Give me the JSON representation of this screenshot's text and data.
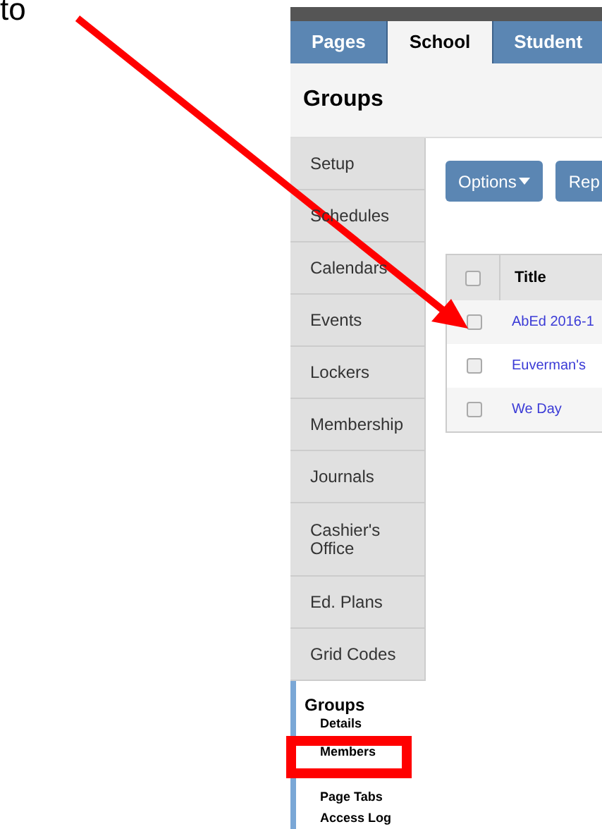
{
  "caption": "to",
  "tabs": [
    {
      "label": "Pages",
      "selected": false
    },
    {
      "label": "School",
      "selected": true
    },
    {
      "label": "Student",
      "selected": false
    }
  ],
  "page_title": "Groups",
  "sidebar": {
    "items": [
      "Setup",
      "Schedules",
      "Calendars",
      "Events",
      "Lockers",
      "Membership",
      "Journals",
      "Cashier's Office",
      "Ed. Plans",
      "Grid Codes"
    ],
    "section": {
      "title": "Groups",
      "links": [
        "Details",
        "Members",
        "Page Tabs",
        "Access Log"
      ]
    }
  },
  "toolbar": {
    "buttons": [
      {
        "label": "Options",
        "kind": "menu"
      },
      {
        "label": "Rep",
        "kind": "plain"
      }
    ]
  },
  "table": {
    "header_checked": false,
    "columns": [
      "Title"
    ],
    "rows": [
      {
        "title": "AbEd 2016-1",
        "checked": false
      },
      {
        "title": "Euverman's",
        "checked": false
      },
      {
        "title": "We Day",
        "checked": false
      }
    ]
  }
}
